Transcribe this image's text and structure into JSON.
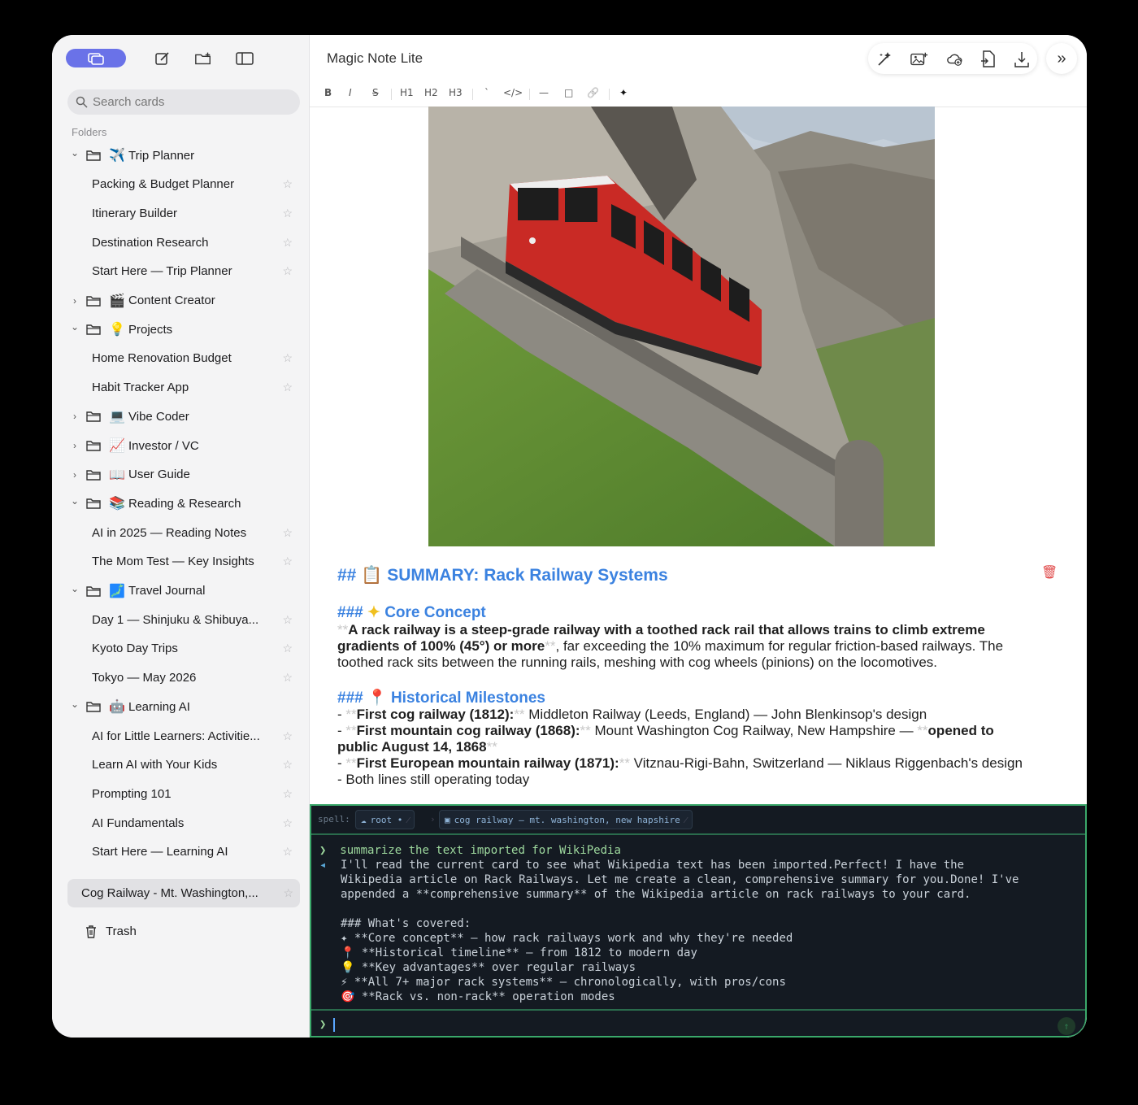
{
  "app": {
    "title": "Magic Note Lite"
  },
  "sidebar": {
    "search_placeholder": "Search cards",
    "folders_label": "Folders",
    "tree": [
      {
        "type": "folder",
        "expanded": true,
        "emoji": "✈️",
        "label": "Trip Planner"
      },
      {
        "type": "card",
        "label": "Packing & Budget Planner"
      },
      {
        "type": "card",
        "label": "Itinerary Builder"
      },
      {
        "type": "card",
        "label": "Destination Research"
      },
      {
        "type": "card",
        "label": "Start Here — Trip Planner"
      },
      {
        "type": "folder",
        "expanded": false,
        "emoji": "🎬",
        "label": "Content Creator"
      },
      {
        "type": "folder",
        "expanded": true,
        "emoji": "💡",
        "label": "Projects"
      },
      {
        "type": "card",
        "label": "Home Renovation Budget"
      },
      {
        "type": "card",
        "label": "Habit Tracker App"
      },
      {
        "type": "folder",
        "expanded": false,
        "emoji": "💻",
        "label": "Vibe Coder"
      },
      {
        "type": "folder",
        "expanded": false,
        "emoji": "📈",
        "label": "Investor / VC"
      },
      {
        "type": "folder",
        "expanded": false,
        "emoji": "📖",
        "label": "User Guide"
      },
      {
        "type": "folder",
        "expanded": true,
        "emoji": "📚",
        "label": "Reading & Research"
      },
      {
        "type": "card",
        "label": "AI in 2025 — Reading Notes"
      },
      {
        "type": "card",
        "label": "The Mom Test — Key Insights"
      },
      {
        "type": "folder",
        "expanded": true,
        "emoji": "🗾",
        "label": "Travel Journal"
      },
      {
        "type": "card",
        "label": "Day 1 — Shinjuku & Shibuya..."
      },
      {
        "type": "card",
        "label": "Kyoto Day Trips"
      },
      {
        "type": "card",
        "label": "Tokyo — May 2026"
      },
      {
        "type": "folder",
        "expanded": true,
        "emoji": "🤖",
        "label": "Learning AI"
      },
      {
        "type": "card",
        "label": "AI for Little Learners: Activitie..."
      },
      {
        "type": "card",
        "label": "Learn AI with Your Kids"
      },
      {
        "type": "card",
        "label": "Prompting 101"
      },
      {
        "type": "card",
        "label": "AI Fundamentals"
      },
      {
        "type": "card",
        "label": "Start Here — Learning AI"
      }
    ],
    "selected_card": "Cog Railway - Mt. Washington,...",
    "trash_label": "Trash"
  },
  "toolbar": {
    "bold": "B",
    "italic": "I",
    "strike": "S",
    "h1": "H1",
    "h2": "H2",
    "h3": "H3",
    "inline_code": "`",
    "code_block": "</>",
    "hr": "—",
    "box": "□",
    "link": "🔗",
    "sparkle": "✦"
  },
  "document": {
    "h2_marker": "##",
    "h2_emoji": "📋",
    "h2_text": "SUMMARY: Rack Railway Systems",
    "core": {
      "h3_marker": "###",
      "emoji": "✦",
      "title": "Core Concept",
      "bold_text": "A rack railway is a steep-grade railway with a toothed rack rail that allows trains to climb extreme gradients of 100% (45°) or more",
      "rest_text": ", far exceeding the 10% maximum for regular friction-based railways. The toothed rack sits between the running rails, meshing with cog wheels (pinions) on the locomotives."
    },
    "milestones": {
      "h3_marker": "###",
      "emoji": "📍",
      "title": "Historical Milestones",
      "items": [
        {
          "bold": "First cog railway (1812):",
          "text": " Middleton Railway (Leeds, England) — John Blenkinsop's design",
          "bold2": "",
          "tail": ""
        },
        {
          "bold": "First mountain cog railway (1868):",
          "text": " Mount Washington Cog Railway, New Hampshire — ",
          "bold2": "opened to public August 14, 1868",
          "tail": ""
        },
        {
          "bold": "First European mountain railway (1871):",
          "text": " Vitznau-Rigi-Bahn, Switzerland — Niklaus Riggenbach's design",
          "bold2": "",
          "tail": ""
        }
      ],
      "last_line": "- Both lines still operating today"
    }
  },
  "terminal": {
    "spell_label": "spell:",
    "root_chip": "root •",
    "card_chip": "cog railway – mt. washington, new hapshire",
    "command": "summarize the text imported for WikiPedia",
    "reply_lines": [
      "I'll read the current card to see what Wikipedia text has been imported.Perfect! I have the",
      "Wikipedia article on Rack Railways. Let me create a clean, comprehensive summary for you.Done! I've",
      "appended a **comprehensive summary** of the Wikipedia article on rack railways to your card.",
      "",
      "### What's covered:",
      "✦ **Core concept** — how rack railways work and why they're needed",
      "📍 **Historical timeline** — from 1812 to modern day",
      "💡 **Key advantages** over regular railways",
      "⚡ **All 7+ major rack systems** — chronologically, with pros/cons",
      "🎯 **Rack vs. non-rack** operation modes"
    ],
    "prompt_symbol": "❯",
    "reply_symbol": "◂"
  },
  "colors": {
    "accent": "#6a72e8",
    "heading_blue": "#3b82e0",
    "terminal_bg": "#141a22",
    "terminal_border": "#3aa86a",
    "train_red": "#c92a25"
  }
}
